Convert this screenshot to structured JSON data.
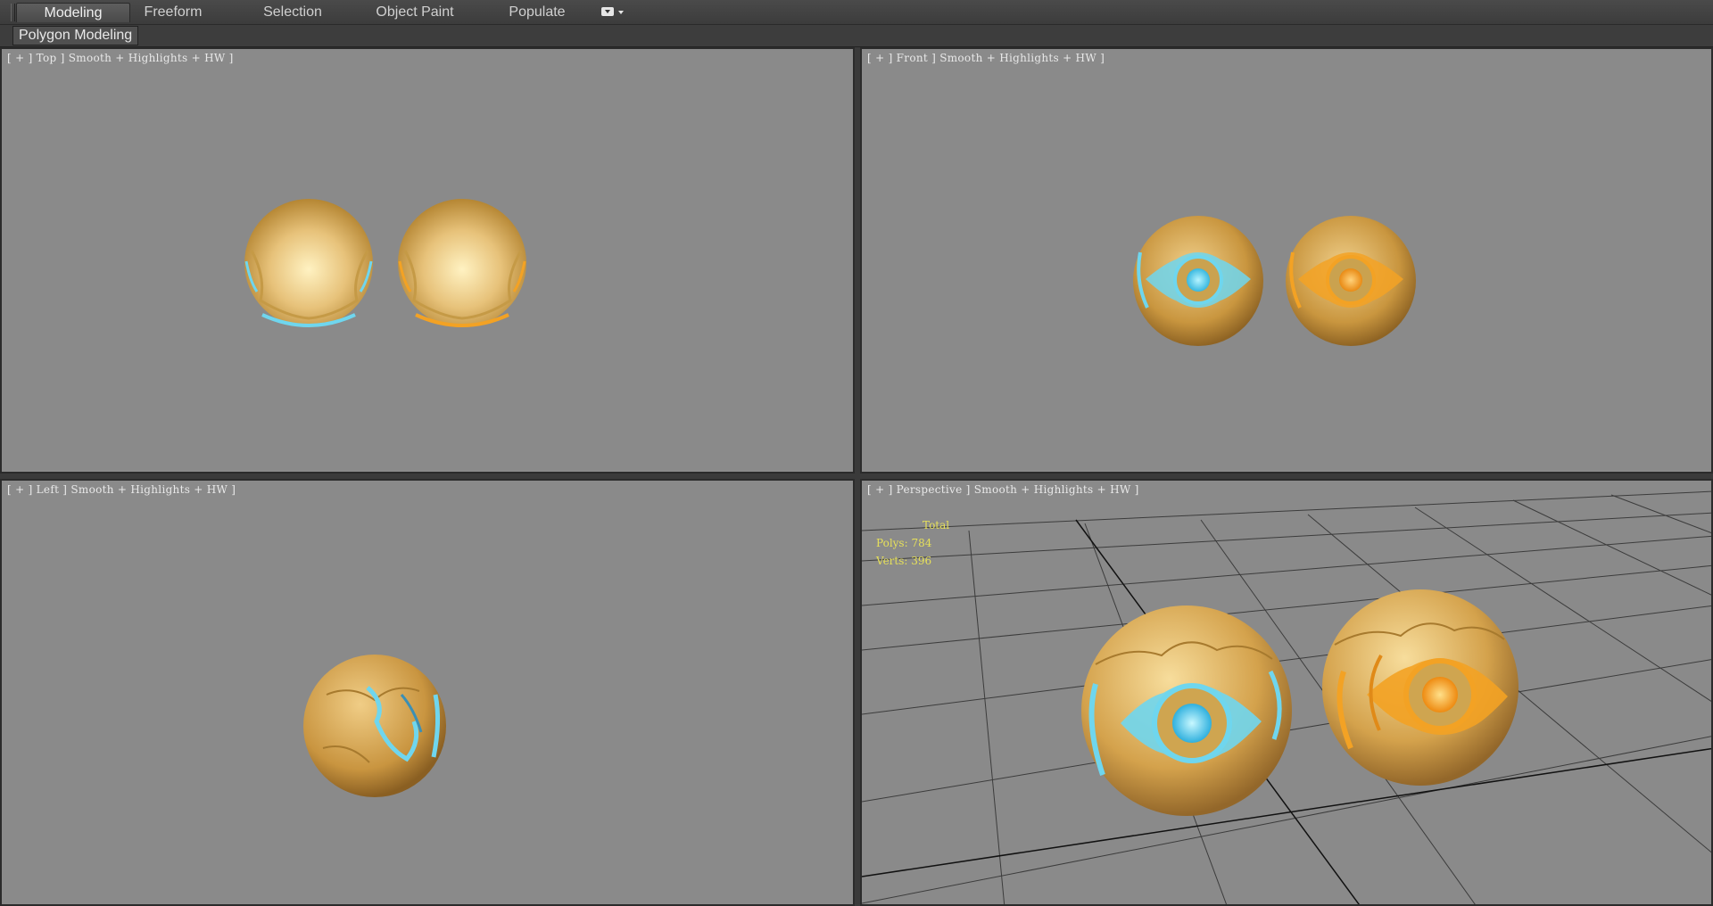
{
  "ribbon": {
    "tabs": [
      {
        "label": "Modeling",
        "active": true
      },
      {
        "label": "Freeform",
        "active": false
      },
      {
        "label": "Selection",
        "active": false
      },
      {
        "label": "Object Paint",
        "active": false
      },
      {
        "label": "Populate",
        "active": false
      }
    ],
    "panel_label": "Polygon Modeling"
  },
  "viewports": {
    "top": {
      "label": "[ + ] Top ] Smooth + Highlights + HW ]"
    },
    "front": {
      "label": "[ + ] Front ] Smooth + Highlights + HW ]"
    },
    "left": {
      "label": "[ + ] Left ] Smooth + Highlights + HW ]"
    },
    "perspective": {
      "label": "[ + ] Perspective ] Smooth + Highlights + HW ]",
      "stats": {
        "total_label": "Total",
        "polys": "Polys: 784",
        "verts": "Verts: 396"
      }
    }
  },
  "colors": {
    "viewport_bg": "#8a8a8a",
    "sphere_base": "#d9a94f",
    "blue_glow": "#6fd6ee",
    "orange_glow": "#f3a224",
    "stats_text": "#e6e05a"
  }
}
